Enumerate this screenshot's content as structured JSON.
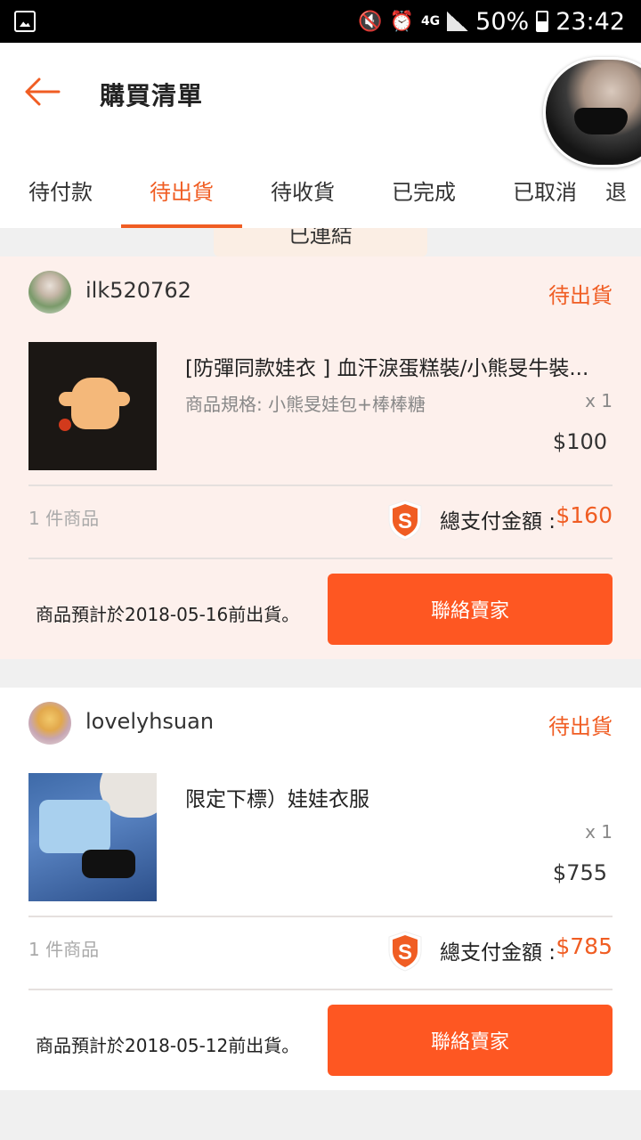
{
  "status_bar": {
    "battery": "50%",
    "time": "23:42",
    "network": "4G"
  },
  "header": {
    "title": "購買清單"
  },
  "tabs": [
    {
      "label": "待付款"
    },
    {
      "label": "待出貨"
    },
    {
      "label": "待收貨"
    },
    {
      "label": "已完成"
    },
    {
      "label": "已取消"
    },
    {
      "label": "退"
    }
  ],
  "toast": {
    "text": "已連結"
  },
  "orders": [
    {
      "shop": "ilk520762",
      "status": "待出貨",
      "product_name": "[防彈同款娃衣 ] 血汗淚蛋糕裝/小熊旻牛裝...",
      "variant": "商品規格: 小熊旻娃包+棒棒糖",
      "qty": "x 1",
      "price": "$100",
      "item_count": "1 件商品",
      "total_label": "總支付金額 :",
      "total": "$160",
      "eta": "商品預計於2018-05-16前出貨。",
      "button": "聯絡賣家"
    },
    {
      "shop": "lovelyhsuan",
      "status": "待出貨",
      "product_name": "限定下標）娃娃衣服",
      "variant": "",
      "qty": "x 1",
      "price": "$755",
      "item_count": "1 件商品",
      "total_label": "總支付金額 :",
      "total": "$785",
      "eta": "商品預計於2018-05-12前出貨。",
      "button": "聯絡賣家"
    }
  ],
  "colors": {
    "accent": "#f05d23",
    "button": "#fe5722",
    "card_highlight": "#fdf0ec"
  }
}
